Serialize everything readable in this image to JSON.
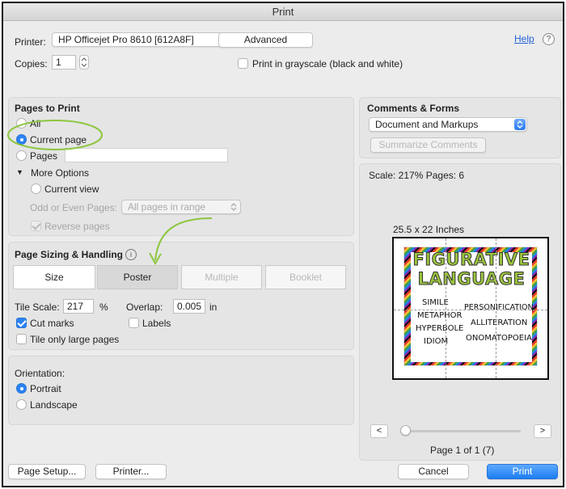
{
  "window": {
    "title": "Print"
  },
  "printer": {
    "label": "Printer:",
    "value": "HP Officejet Pro 8610 [612A8F]",
    "advanced": "Advanced",
    "help": "Help",
    "help_symbol": "?"
  },
  "copies": {
    "label": "Copies:",
    "value": "1",
    "grayscale_label": "Print in grayscale (black and white)"
  },
  "pages_to_print": {
    "heading": "Pages to Print",
    "all": "All",
    "current_page": "Current page",
    "pages": "Pages",
    "more_options": "More Options",
    "current_view": "Current view",
    "odd_even_label": "Odd or Even Pages:",
    "odd_even_value": "All pages in range",
    "reverse_pages": "Reverse pages"
  },
  "page_sizing": {
    "heading": "Page Sizing & Handling",
    "info_symbol": "i",
    "tabs": [
      "Size",
      "Poster",
      "Multiple",
      "Booklet"
    ],
    "selected_tab": "Poster",
    "tile_scale_label": "Tile Scale:",
    "tile_scale_value": "217",
    "tile_scale_unit": "%",
    "overlap_label": "Overlap:",
    "overlap_value": "0.005",
    "overlap_unit": "in",
    "cut_marks": "Cut marks",
    "labels": "Labels",
    "tile_large": "Tile only large pages"
  },
  "orientation": {
    "heading": "Orientation:",
    "portrait": "Portrait",
    "landscape": "Landscape"
  },
  "comments_forms": {
    "heading": "Comments & Forms",
    "value": "Document and Markups",
    "summarize": "Summarize Comments"
  },
  "preview": {
    "scale_text": "Scale: 217% Pages: 6",
    "size_text": "25.5 x 22 Inches",
    "poster_title_1": "FIGURATIVE",
    "poster_title_2": "LANGUAGE",
    "left_terms": [
      "SIMILE",
      "METAPHOR",
      "HYPERBOLE",
      "IDIOM"
    ],
    "right_terms": [
      "PERSONIFICATION",
      "ALLITERATION",
      "ONOMATOPOEIA"
    ],
    "prev": "<",
    "next": ">",
    "page_indicator": "Page 1 of 1 (7)"
  },
  "footer": {
    "page_setup": "Page Setup...",
    "printer": "Printer...",
    "cancel": "Cancel",
    "print": "Print"
  },
  "colors": {
    "accent_blue": "#2a82f5",
    "annotation_green": "#8cc63f",
    "poster_title_green": "#9bc53d"
  }
}
